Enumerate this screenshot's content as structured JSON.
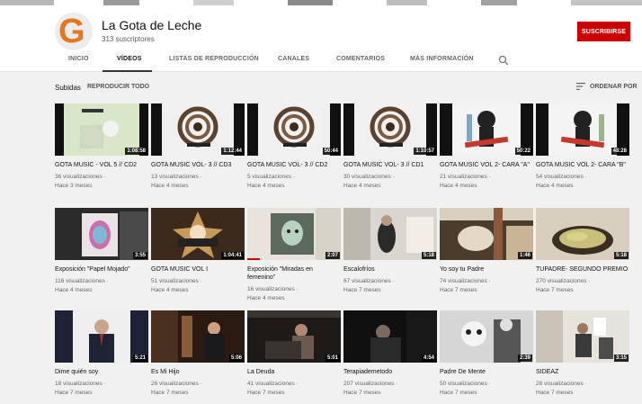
{
  "channel": {
    "name": "La Gota de Leche",
    "subscribers": "313 suscriptores",
    "avatar_letter": "G",
    "subscribe_label": "SUSCRIBIRSE"
  },
  "tabs": [
    {
      "label": "INICIO",
      "active": false
    },
    {
      "label": "VÍDEOS",
      "active": true
    },
    {
      "label": "LISTAS DE REPRODUCCIÓN",
      "active": false
    },
    {
      "label": "CANALES",
      "active": false
    },
    {
      "label": "COMENTARIOS",
      "active": false
    },
    {
      "label": "MÁS INFORMACIÓN",
      "active": false
    }
  ],
  "section": {
    "title": "Subidas",
    "play_all": "REPRODUCIR TODO",
    "sort_label": "ORDENAR POR"
  },
  "videos": [
    {
      "title": "GOTA MUSIC - VOL 5 // CD2",
      "duration": "1:08:58",
      "views": "36 visualizaciones",
      "age": "Hace 3 meses"
    },
    {
      "title": "GOTA MUSIC VOL- 3 // CD3",
      "duration": "1:12:44",
      "views": "13 visualizaciones",
      "age": "Hace 4 meses"
    },
    {
      "title": "GOTA MUSIC VOL- 3 // CD2",
      "duration": "50:44",
      "views": "5 visualizaciones",
      "age": "Hace 4 meses"
    },
    {
      "title": "GOTA MUSIC VOL- 3 // CD1",
      "duration": "1:10:57",
      "views": "30 visualizaciones",
      "age": "Hace 4 meses"
    },
    {
      "title": "GOTA MUSIC VOL 2- CARA \"A\"",
      "duration": "50:22",
      "views": "21 visualizaciones",
      "age": "Hace 4 meses"
    },
    {
      "title": "GOTA MUSIC VOL 2- CARA \"B\"",
      "duration": "48:28",
      "views": "54 visualizaciones",
      "age": "Hace 4 meses"
    },
    {
      "title": "Exposición \"Papel Mojado\"",
      "duration": "3:55",
      "views": "116 visualizaciones",
      "age": "Hace 4 meses"
    },
    {
      "title": "GOTA MUSIC VOL I",
      "duration": "1:04:41",
      "views": "51 visualizaciones",
      "age": "Hace 4 meses"
    },
    {
      "title": "Exposición \"Miradas en femenino\"",
      "duration": "2:07",
      "views": "16 visualizaciones",
      "age": "Hace 4 meses"
    },
    {
      "title": "Escalofríos",
      "duration": "5:18",
      "views": "67 visualizaciones",
      "age": "Hace 7 meses"
    },
    {
      "title": "Yo soy tu Padre",
      "duration": "1:46",
      "views": "74 visualizaciones",
      "age": "Hace 7 meses"
    },
    {
      "title": "TUPADRE- SEGUNDO PREMIO",
      "duration": "5:18",
      "views": "270 visualizaciones",
      "age": "Hace 7 meses"
    },
    {
      "title": "Dime quién soy",
      "duration": "5:21",
      "views": "18 visualizaciones",
      "age": "Hace 7 meses"
    },
    {
      "title": "Es Mi Hijo",
      "duration": "5:06",
      "views": "26 visualizaciones",
      "age": "Hace 7 meses"
    },
    {
      "title": "La Deuda",
      "duration": "5:01",
      "views": "41 visualizaciones",
      "age": "Hace 7 meses"
    },
    {
      "title": "Terapiademetodo",
      "duration": "4:54",
      "views": "207 visualizaciones",
      "age": "Hace 7 meses"
    },
    {
      "title": "Padre De Mente",
      "duration": "2:39",
      "views": "50 visualizaciones",
      "age": "Hace 7 meses"
    },
    {
      "title": "SIDEAZ",
      "duration": "3:15",
      "views": "28 visualizaciones",
      "age": "Hace 7 meses"
    }
  ],
  "colors": {
    "brand_red": "#cc0000",
    "avatar_orange": "#e8751a"
  },
  "icons": {
    "search": "search-icon",
    "sort": "sort-icon"
  }
}
